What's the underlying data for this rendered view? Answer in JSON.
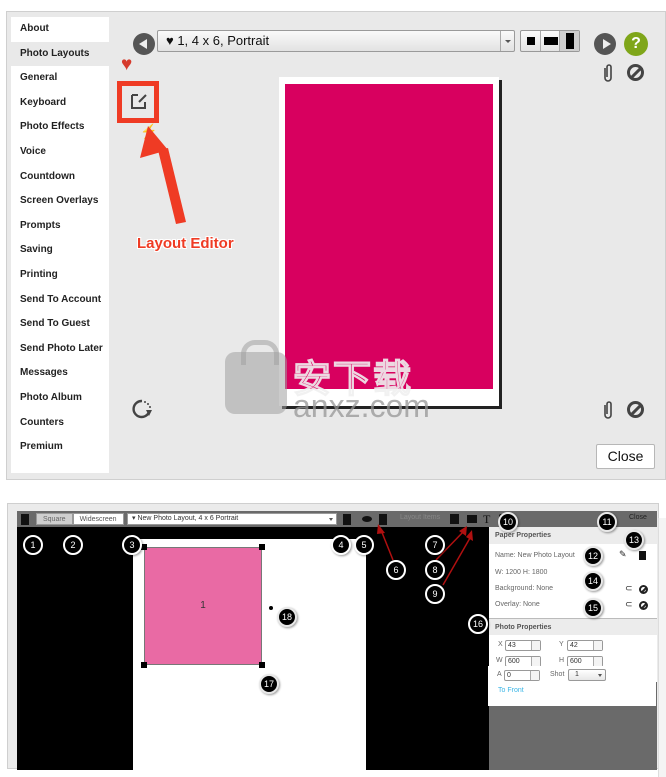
{
  "top_window": {
    "sidebar": {
      "items": [
        {
          "label": "About",
          "active": false
        },
        {
          "label": "Photo Layouts",
          "active": true
        },
        {
          "label": "General",
          "active": false
        },
        {
          "label": "Keyboard",
          "active": false
        },
        {
          "label": "Photo Effects",
          "active": false
        },
        {
          "label": "Voice",
          "active": false
        },
        {
          "label": "Countdown",
          "active": false
        },
        {
          "label": "Screen Overlays",
          "active": false
        },
        {
          "label": "Prompts",
          "active": false
        },
        {
          "label": "Saving",
          "active": false
        },
        {
          "label": "Printing",
          "active": false
        },
        {
          "label": "Send To Account",
          "active": false
        },
        {
          "label": "Send To Guest",
          "active": false
        },
        {
          "label": "Send Photo Later",
          "active": false
        },
        {
          "label": "Messages",
          "active": false
        },
        {
          "label": "Photo Album",
          "active": false
        },
        {
          "label": "Counters",
          "active": false
        },
        {
          "label": "Premium",
          "active": false
        }
      ]
    },
    "layout_select": {
      "value": "♥ 1, 4 x 6, Portrait"
    },
    "aspect_options": [
      "square",
      "widescreen",
      "portrait"
    ],
    "aspect_selected": "portrait",
    "help_label": "?",
    "annotation": {
      "label": "Layout Editor",
      "color": "#ef3b24"
    },
    "photo_color": "#d8005f",
    "close_label": "Close",
    "icons": {
      "prev": "chevron-left-icon",
      "next": "chevron-right-icon",
      "help": "help-icon",
      "attach": "paperclip-icon",
      "clear": "no-entry-icon",
      "favorite": "heart-icon",
      "edit": "edit-icon",
      "flash": "lightning-icon",
      "refresh": "refresh-icon"
    },
    "watermark": {
      "cn": "安下载",
      "en": "anxz.com",
      "badge": "安"
    }
  },
  "bottom_window": {
    "toolbar": {
      "square_label": "Square",
      "widescreen_label": "Widescreen",
      "layout_select_value": "▾ New Photo Layout, 4 x 6 Portrait",
      "layout_items_label": "Layout Items",
      "close_label": "Close"
    },
    "canvas": {
      "photo_number": "1",
      "photo_color": "#e96aa4"
    },
    "paper_properties": {
      "title": "Paper Properties",
      "name": "Name: New Photo Layout",
      "size": "W: 1200 H: 1800",
      "background": "Background: None",
      "overlay": "Overlay: None"
    },
    "photo_properties": {
      "title": "Photo Properties",
      "fields": {
        "x": {
          "label": "X",
          "value": "43"
        },
        "y": {
          "label": "Y",
          "value": "42"
        },
        "w": {
          "label": "W",
          "value": "600"
        },
        "h": {
          "label": "H",
          "value": "600"
        },
        "a": {
          "label": "A",
          "value": "0"
        }
      },
      "shot_label": "Shot",
      "shot_value": "1",
      "to_front_label": "To Front"
    },
    "callouts": [
      "1",
      "2",
      "3",
      "4",
      "5",
      "6",
      "7",
      "8",
      "9",
      "10",
      "11",
      "12",
      "13",
      "14",
      "15",
      "16",
      "17",
      "18"
    ]
  }
}
